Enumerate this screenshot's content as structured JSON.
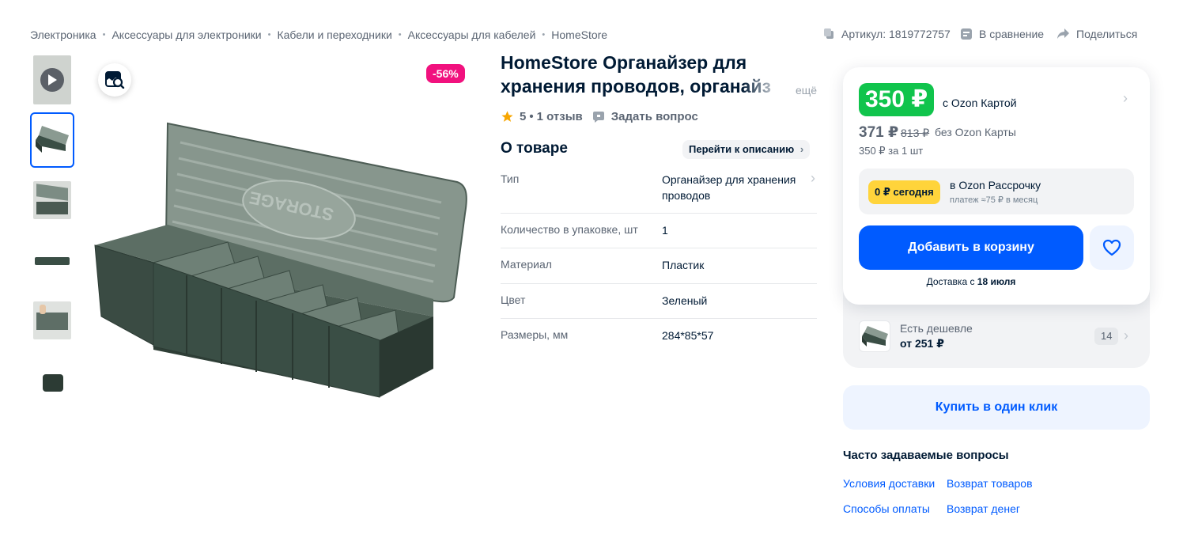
{
  "breadcrumbs": [
    "Электроника",
    "Аксессуары для электроники",
    "Кабели и переходники",
    "Аксессуары для кабелей",
    "HomeStore"
  ],
  "top_actions": {
    "article": "Артикул: 1819772757",
    "compare": "В сравнение",
    "share": "Поделиться"
  },
  "discount": "-56%",
  "product": {
    "title_line1": "HomeStore Органайзер для",
    "title_line2": "хранения проводов, органайз",
    "more": "ещё",
    "rating": "5",
    "reviews": "1 отзыв",
    "ask": "Задать вопрос"
  },
  "about": {
    "heading": "О товаре",
    "to_description": "Перейти к описанию",
    "specs": [
      {
        "key": "Тип",
        "value": "Органайзер для хранения проводов"
      },
      {
        "key": "Количество в упаковке, шт",
        "value": "1"
      },
      {
        "key": "Материал",
        "value": "Пластик"
      },
      {
        "key": "Цвет",
        "value": "Зеленый"
      },
      {
        "key": "Размеры, мм",
        "value": "284*85*57"
      }
    ]
  },
  "buy": {
    "price_card": "350 ₽",
    "with_card": "с Ozon Картой",
    "price_regular": "371 ₽",
    "price_old": "813 ₽",
    "without_card": "без Ozon Карты",
    "per_unit": "350 ₽ за 1 шт",
    "installment_badge": "0 ₽ сегодня",
    "installment_title": "в Ozon Рассрочку",
    "installment_sub": "платеж ≈75 ₽ в месяц",
    "add_to_cart": "Добавить в корзину",
    "delivery_prefix": "Доставка с ",
    "delivery_date": "18 июля",
    "cheaper_title": "Есть дешевле",
    "cheaper_price": "от 251 ₽",
    "cheaper_count": "14",
    "one_click": "Купить в один клик"
  },
  "faq": {
    "title": "Часто задаваемые вопросы",
    "links": [
      "Условия доставки",
      "Возврат товаров",
      "Способы оплаты",
      "Возврат денег"
    ]
  },
  "colors": {
    "accent": "#005bff",
    "green_price": "#10c44c",
    "discount": "#f1117e",
    "installment": "#ffd43b",
    "product": "#3a4e45"
  }
}
